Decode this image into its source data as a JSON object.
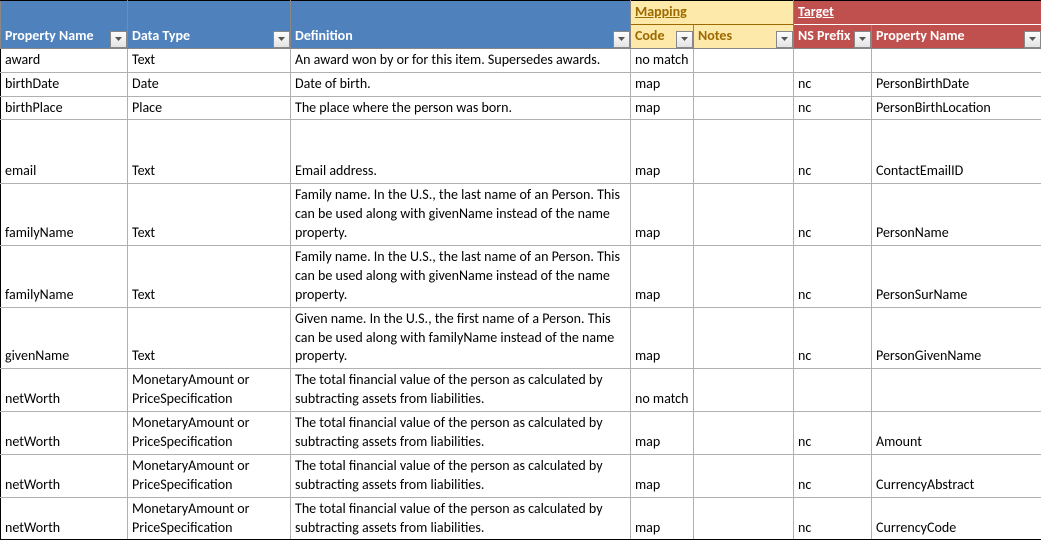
{
  "headers": {
    "super": {
      "mapping": "Mapping",
      "target": "Target"
    },
    "cols": [
      "Property Name",
      "Data Type",
      "Definition",
      "Code",
      "Notes",
      "NS Prefix",
      "Property Name"
    ]
  },
  "rows": [
    {
      "p": "award",
      "t": "Text",
      "d": "An award won by or for this item. Supersedes awards.",
      "c": "no match",
      "n": "",
      "ns": "",
      "pn": ""
    },
    {
      "p": "birthDate",
      "t": "Date",
      "d": "Date of birth.",
      "c": "map",
      "n": "",
      "ns": "nc",
      "pn": "PersonBirthDate"
    },
    {
      "p": "birthPlace",
      "t": "Place",
      "d": "The place where the person was born.",
      "c": "map",
      "n": "",
      "ns": "nc",
      "pn": "PersonBirthLocation"
    },
    {
      "p": "email",
      "t": "Text",
      "d": "Email address.",
      "c": "map",
      "n": "",
      "ns": "nc",
      "pn": "ContactEmailID",
      "pad": true
    },
    {
      "p": "familyName",
      "t": "Text",
      "d": "Family name. In the U.S., the last name of an Person. This can be used along with givenName instead of the name property.",
      "c": "map",
      "n": "",
      "ns": "nc",
      "pn": "PersonName"
    },
    {
      "p": "familyName",
      "t": "Text",
      "d": "Family name. In the U.S., the last name of an Person. This can be used along with givenName instead of the name property.",
      "c": "map",
      "n": "",
      "ns": "nc",
      "pn": "PersonSurName"
    },
    {
      "p": "givenName",
      "t": "Text",
      "d": "Given name. In the U.S., the first name of a Person. This can be used along with familyName instead of the name property.",
      "c": "map",
      "n": "",
      "ns": "nc",
      "pn": "PersonGivenName"
    },
    {
      "p": "netWorth",
      "t": "MonetaryAmount or PriceSpecification",
      "d": "The total financial value of the person as calculated by subtracting assets from liabilities.",
      "c": "no match",
      "n": "",
      "ns": "",
      "pn": ""
    },
    {
      "p": "netWorth",
      "t": "MonetaryAmount or PriceSpecification",
      "d": "The total financial value of the person as calculated by subtracting assets from liabilities.",
      "c": "map",
      "n": "",
      "ns": "nc",
      "pn": "Amount"
    },
    {
      "p": "netWorth",
      "t": "MonetaryAmount or PriceSpecification",
      "d": "The total financial value of the person as calculated by subtracting assets from liabilities.",
      "c": "map",
      "n": "",
      "ns": "nc",
      "pn": "CurrencyAbstract"
    },
    {
      "p": "netWorth",
      "t": "MonetaryAmount or PriceSpecification",
      "d": "The total financial value of the person as calculated by subtracting assets from liabilities.",
      "c": "map",
      "n": "",
      "ns": "nc",
      "pn": "CurrencyCode"
    }
  ]
}
